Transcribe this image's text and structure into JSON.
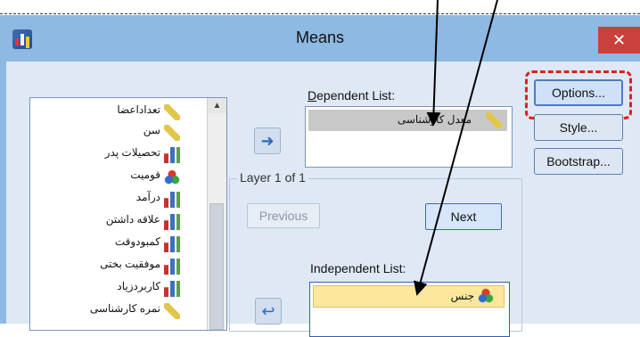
{
  "window": {
    "title": "Means",
    "close_glyph": "✕"
  },
  "variables": [
    {
      "label": "تعداداعضا",
      "icon": "ruler-icon"
    },
    {
      "label": "سن",
      "icon": "ruler-icon"
    },
    {
      "label": "تحصیلات پدر",
      "icon": "bar-chart-icon"
    },
    {
      "label": "قومیت",
      "icon": "nominal-balls-icon"
    },
    {
      "label": "درآمد",
      "icon": "bar-chart-icon"
    },
    {
      "label": "علاقه داشتن",
      "icon": "bar-chart-icon"
    },
    {
      "label": "کمبودوقت",
      "icon": "bar-chart-icon"
    },
    {
      "label": "موفقیت بختی",
      "icon": "bar-chart-icon"
    },
    {
      "label": "کاربردزیاد",
      "icon": "bar-chart-icon"
    },
    {
      "label": "نمره کارشناسی",
      "icon": "ruler-icon"
    }
  ],
  "dependent": {
    "label_prefix": "D",
    "label_rest": "ependent List:",
    "items": [
      {
        "label": "معدل کارشناسی",
        "icon": "ruler-icon"
      }
    ]
  },
  "layer": {
    "caption": "Layer 1 of 1",
    "previous_label": "Previous",
    "next_label": "Next"
  },
  "independent": {
    "label": "Independent List:",
    "items": [
      {
        "label": "جنس",
        "icon": "nominal-balls-icon"
      }
    ]
  },
  "buttons": {
    "options": "Options...",
    "style": "Style...",
    "bootstrap": "Bootstrap..."
  },
  "colors": {
    "titlebar": "#8db9e3",
    "client": "#dfe9f5",
    "close": "#c9413a",
    "highlight": "#e02020"
  }
}
